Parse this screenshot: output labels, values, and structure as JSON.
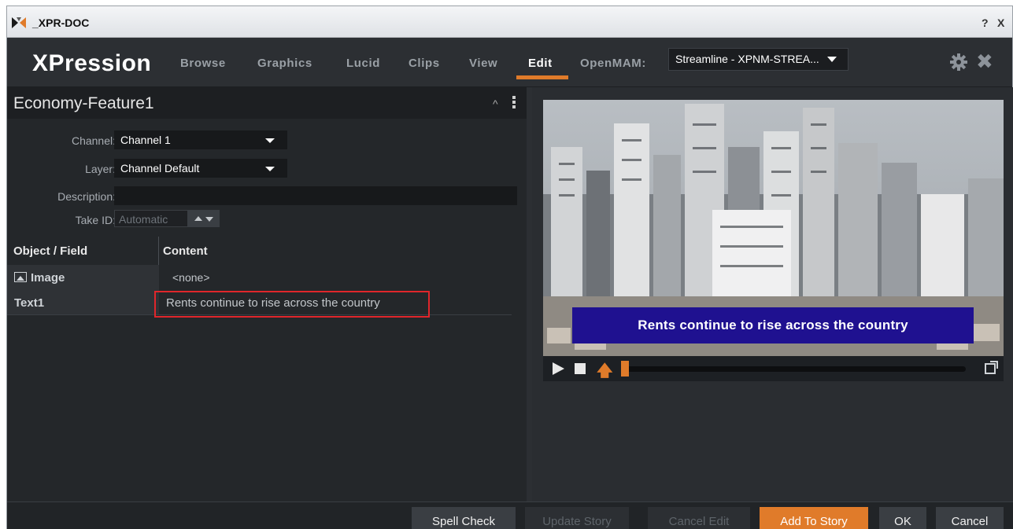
{
  "window": {
    "title": "_XPR-DOC",
    "help_label": "?",
    "close_label": "X"
  },
  "nav": {
    "logo": "XPression",
    "items": [
      "Browse",
      "Graphics",
      "Lucid",
      "Clips",
      "View",
      "Edit",
      "OpenMAM:"
    ],
    "active": "Edit",
    "stream_select": "Streamline - XPNM-STREA...",
    "settings_icon": "gear-icon",
    "close_icon": "close-icon"
  },
  "panel": {
    "title": "Economy-Feature1",
    "fields": {
      "channel_label": "Channel:",
      "channel_value": "Channel 1",
      "layer_label": "Layer:",
      "layer_value": "Channel Default",
      "description_label": "Description:",
      "description_value": "",
      "takeid_label": "Take ID:",
      "takeid_value": "Automatic"
    },
    "grid": {
      "col1": "Object / Field",
      "col2": "Content",
      "rows": [
        {
          "field": "Image",
          "content": "<none>",
          "icon": "image-icon"
        },
        {
          "field": "Text1",
          "content": "Rents continue to rise across the country"
        }
      ]
    }
  },
  "preview": {
    "lower_third": "Rents continue to rise across the country",
    "accent": "#e07b2a",
    "lower_third_color": "#1f1190"
  },
  "footer": {
    "spell_check": "Spell Check",
    "update_story": "Update Story",
    "cancel_edit": "Cancel Edit",
    "add_to_story": "Add To Story",
    "ok": "OK",
    "cancel": "Cancel"
  }
}
